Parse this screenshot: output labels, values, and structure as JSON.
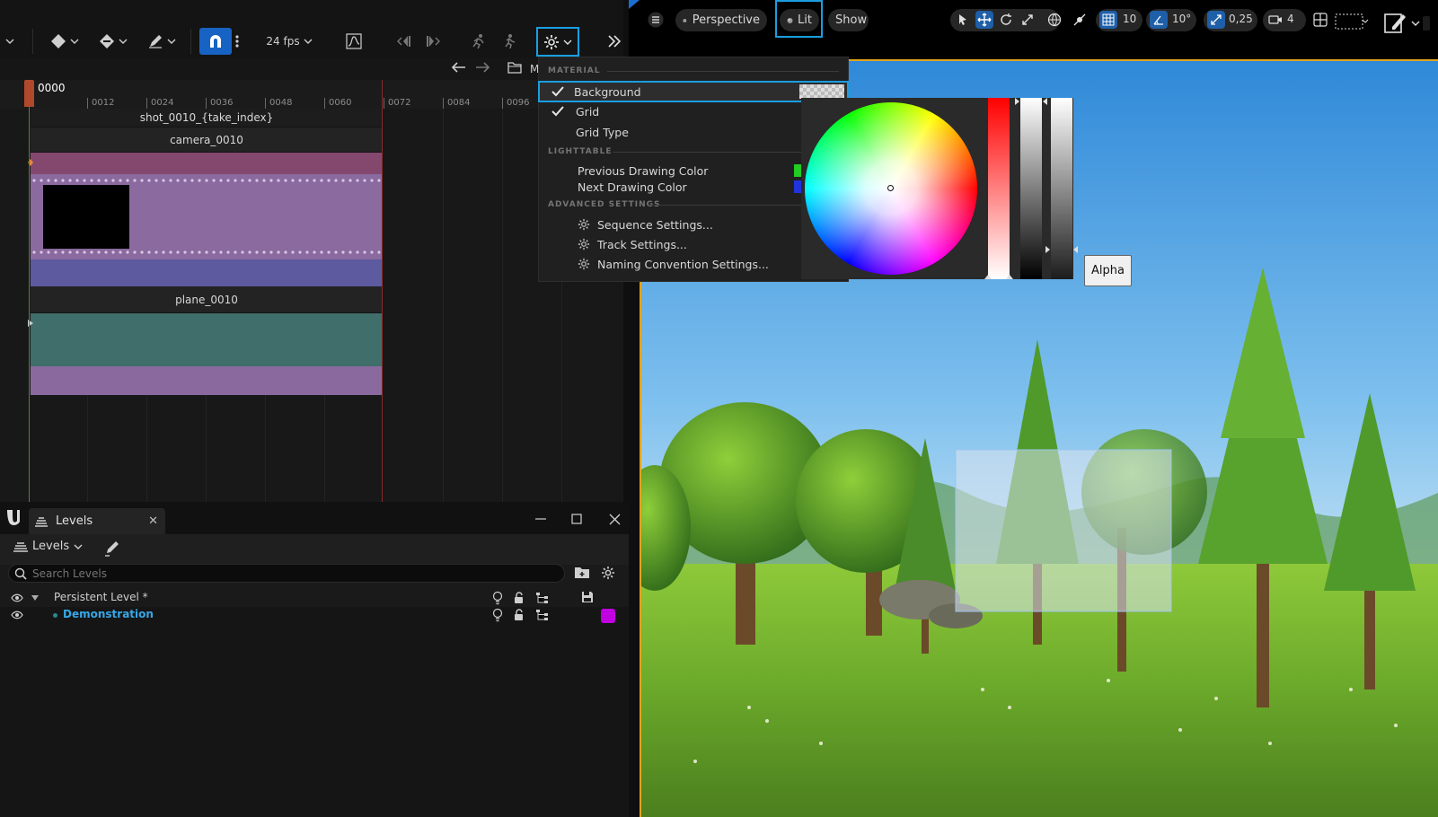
{
  "sequencer": {
    "toolbar": {
      "fps_label": "24 fps"
    },
    "ruler": {
      "current_frame": "0000",
      "ticks": [
        "0012",
        "0024",
        "0036",
        "0048",
        "0060",
        "0072",
        "0084",
        "0096"
      ]
    },
    "tracks": {
      "shot_label": "shot_0010_{take_index}",
      "camera_label": "camera_0010",
      "plane_label": "plane_0010"
    },
    "next_panel_initial": "M"
  },
  "levels": {
    "tab_label": "Levels",
    "dropdown_label": "Levels",
    "search_placeholder": "Search Levels",
    "rows": [
      {
        "name": "Persistent Level *"
      },
      {
        "name": "Demonstration",
        "color": "#c000e0"
      }
    ]
  },
  "viewport": {
    "toolbar": {
      "perspective_label": "Perspective",
      "lit_label": "Lit",
      "show_label": "Show",
      "grid_snap": "10",
      "rotation_snap": "10°",
      "scale_snap": "0,25",
      "camera_speed": "4"
    }
  },
  "settings_menu": {
    "sections": {
      "material": "MATERIAL",
      "lighttable": "LIGHTTABLE",
      "advanced": "ADVANCED SETTINGS"
    },
    "items": {
      "background": "Background",
      "grid": "Grid",
      "grid_type": "Grid Type",
      "previous_drawing_color": "Previous Drawing Color",
      "next_drawing_color": "Next Drawing Color",
      "sequence_settings": "Sequence Settings...",
      "track_settings": "Track Settings...",
      "naming_settings": "Naming Convention Settings..."
    },
    "colors": {
      "previous": "#22cc22",
      "next": "#2233dd"
    }
  },
  "color_picker": {
    "alpha_label": "Alpha"
  }
}
